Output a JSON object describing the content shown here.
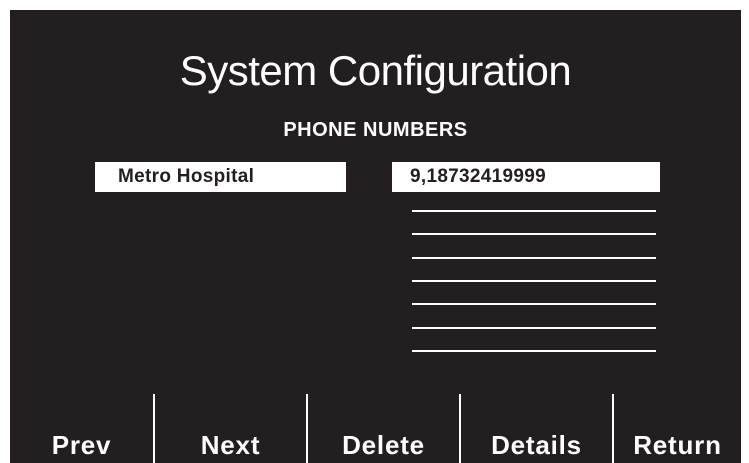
{
  "screen": {
    "title": "System Configuration",
    "subtitle": "PHONE NUMBERS"
  },
  "entries": [
    {
      "name": "Metro Hospital",
      "number": "9,18732419999"
    }
  ],
  "blank_slots": 7,
  "softkeys": [
    {
      "id": "prev",
      "label": "Prev"
    },
    {
      "id": "next",
      "label": "Next"
    },
    {
      "id": "delete",
      "label": "Delete"
    },
    {
      "id": "details",
      "label": "Details"
    },
    {
      "id": "return",
      "label": "Return"
    }
  ],
  "colors": {
    "screen_background": "#231f20",
    "foreground": "#ffffff",
    "field_text": "#231f20"
  }
}
